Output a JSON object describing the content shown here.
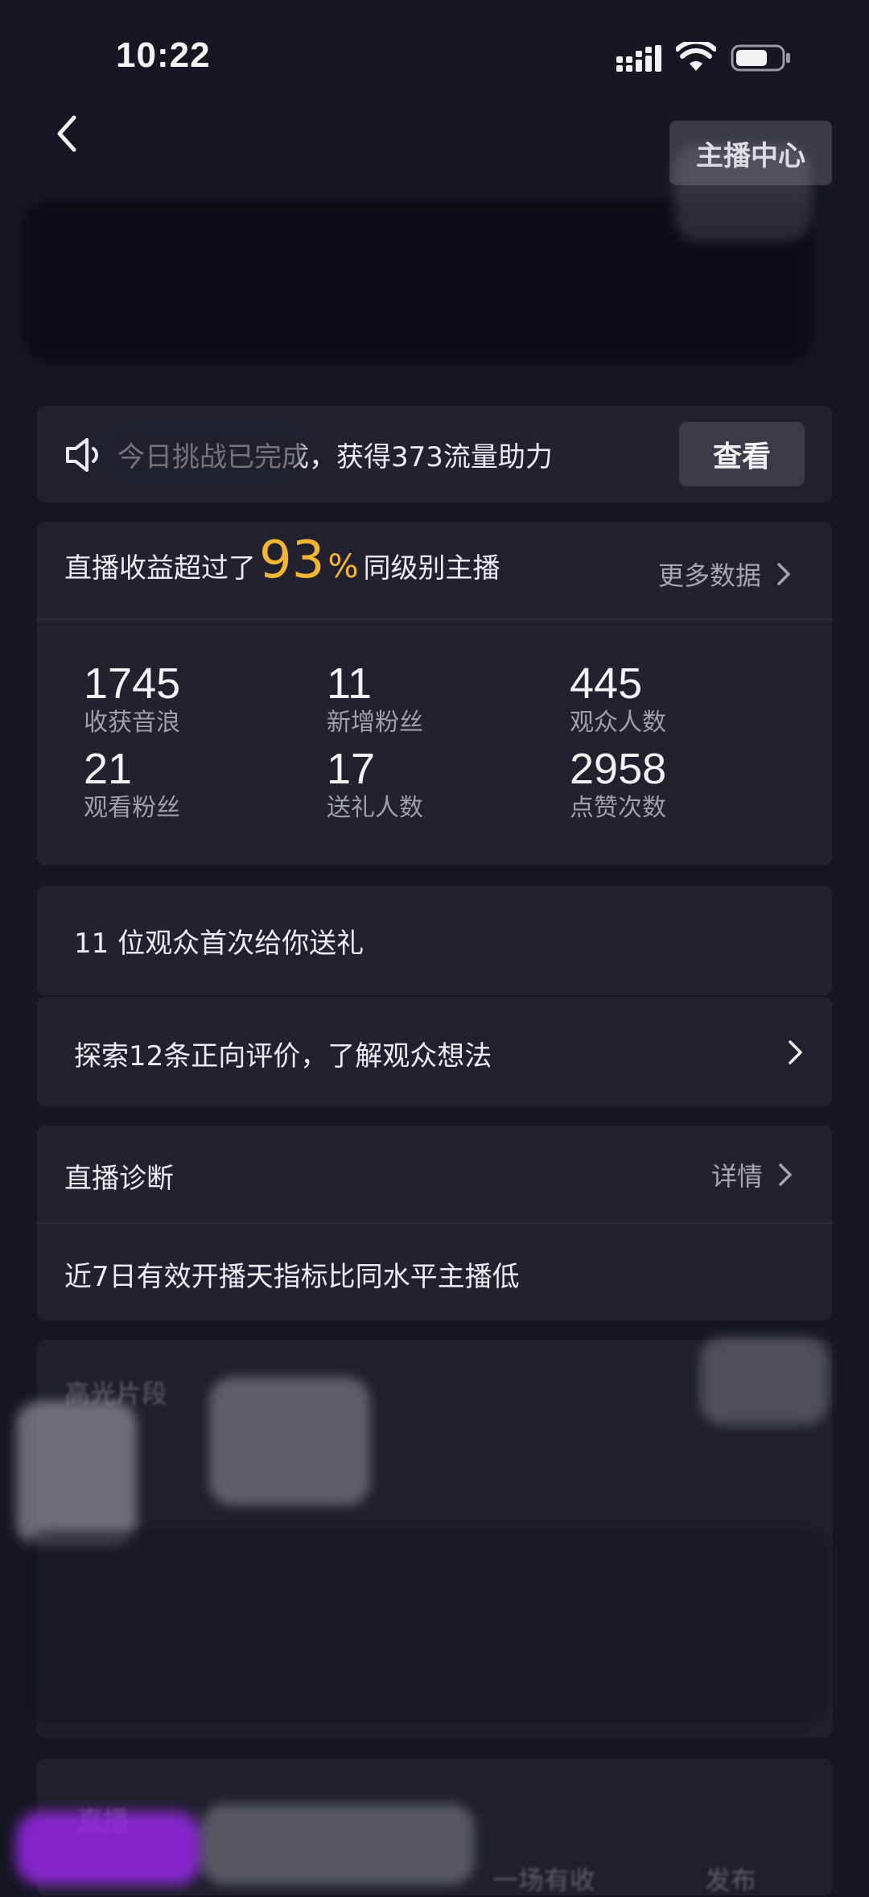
{
  "status_bar": {
    "time": "10:22"
  },
  "nav": {
    "anchor_center_label": "主播中心"
  },
  "notice": {
    "text": "今日挑战已完成，获得373流量助力",
    "view_button": "查看"
  },
  "stats": {
    "headline_prefix": "直播收益超过了",
    "percent_value": "93",
    "percent_sign": "%",
    "headline_suffix": "同级别主播",
    "more_data": "更多数据",
    "metrics": [
      {
        "value": "1745",
        "label": "收获音浪"
      },
      {
        "value": "11",
        "label": "新增粉丝"
      },
      {
        "value": "445",
        "label": "观众人数"
      },
      {
        "value": "21",
        "label": "观看粉丝"
      },
      {
        "value": "17",
        "label": "送礼人数"
      },
      {
        "value": "2958",
        "label": "点赞次数"
      }
    ]
  },
  "gift": {
    "text": "11 位观众首次给你送礼"
  },
  "explore": {
    "text": "探索12条正向评价，了解观众想法"
  },
  "diagnosis": {
    "title": "直播诊断",
    "detail": "详情",
    "text": "近7日有效开播天指标比同水平主播低"
  },
  "lower": {
    "card1_title": "高光片段",
    "card2_title": "直播",
    "card2_sub": "一场有收",
    "card2_right": "发布"
  },
  "colors": {
    "background": "#161722",
    "card": "#21222e",
    "accent": "#f2b632",
    "muted_text": "#a5a6b0"
  }
}
